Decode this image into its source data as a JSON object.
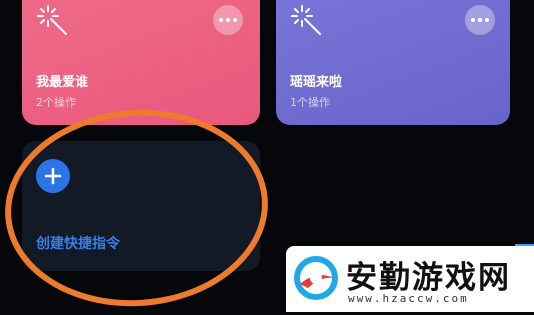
{
  "shortcuts": [
    {
      "title": "我最爱谁",
      "subtitle": "2个操作",
      "color": "#ec6283"
    },
    {
      "title": "瑶瑶来啦",
      "subtitle": "1个操作",
      "color": "#716cd0"
    }
  ],
  "create": {
    "label": "创建快捷指令",
    "accent": "#2d73e8"
  },
  "annotation": {
    "color": "#ee7a2e"
  },
  "watermark": {
    "name": "安勤游戏网",
    "url": "www.hzaccw.com"
  }
}
